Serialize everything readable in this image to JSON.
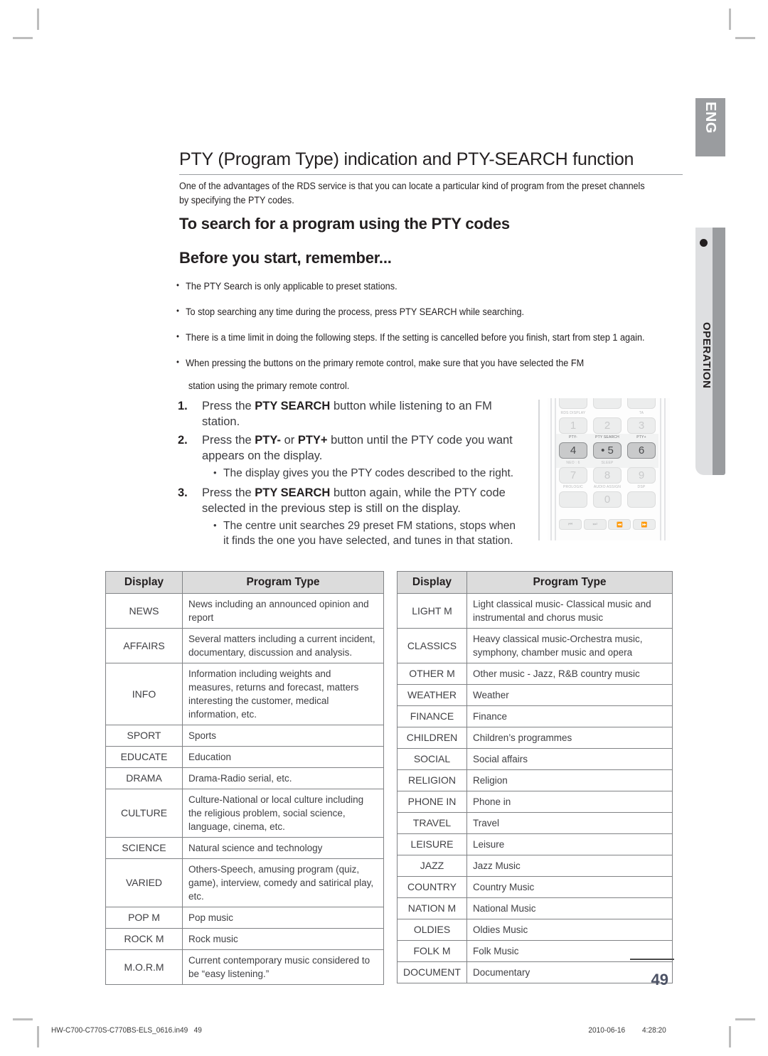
{
  "sidebar": {
    "lang_tab": "ENG",
    "section_tab": "OPERATION"
  },
  "section": {
    "title": "PTY (Program Type) indication and PTY-SEARCH function",
    "intro": "One  of the advantages of the RDS service is that you can locate a particular kind of program from the preset channels by specifying the PTY codes.",
    "heading_1": "To search for a program using the PTY codes",
    "heading_2": "Before you start, remember..."
  },
  "notes": [
    "The PTY Search is only applicable to preset stations.",
    "To stop searching any time during the process, press PTY SEARCH while searching.",
    "There is a time limit in doing the following steps. If the setting is cancelled before you finish,  start from step 1 again.",
    "When pressing the buttons on the primary remote control, make sure that you have selected the FM",
    "station using the primary remote control."
  ],
  "steps": [
    {
      "number": "1.",
      "text_before": "Press the ",
      "bold": "PTY SEARCH",
      "text_after": " button while listening to an FM station.",
      "sub": []
    },
    {
      "number": "2.",
      "text_before": "Press the ",
      "bold": "PTY-",
      "mid": " or ",
      "bold2": "PTY+",
      "text_after": " button until the PTY code you want appears on the display.",
      "sub": [
        "The display gives you the PTY codes described to the right."
      ]
    },
    {
      "number": "3.",
      "text_before": "Press the ",
      "bold": "PTY SEARCH",
      "text_after": " button again, while the PTY code selected in the previous step is still on the display.",
      "sub": [
        "The centre unit searches 29 preset FM stations, stops when it finds the one you have selected, and tunes in that station."
      ]
    }
  ],
  "remote": {
    "labels_row1": [
      "RDS DISPLAY",
      "",
      "TA"
    ],
    "keys_row1": [
      "1",
      "2",
      "3"
    ],
    "labels_row2": [
      "PTY-",
      "PTY SEARCH",
      "PTY+"
    ],
    "keys_row2": [
      "4",
      "• 5",
      "6"
    ],
    "labels_row3": [
      "NEO : 6",
      "SLEEP",
      ""
    ],
    "keys_row3": [
      "7",
      "8",
      "9"
    ],
    "labels_row4": [
      "PROLOGIC",
      "AUDIO ASSIGN",
      "DSP"
    ],
    "keys_row4": [
      "",
      "0",
      ""
    ],
    "transport": [
      "⏮",
      "⏭",
      "⏪",
      "⏩"
    ]
  },
  "table_left": {
    "headers": [
      "Display",
      "Program Type"
    ],
    "rows": [
      [
        "NEWS",
        "News including an announced opinion and report"
      ],
      [
        "AFFAIRS",
        "Several matters including a current incident, documentary, discussion and analysis."
      ],
      [
        "INFO",
        "Information including weights and measures, returns and forecast, matters interesting the customer, medical information, etc."
      ],
      [
        "SPORT",
        "Sports"
      ],
      [
        "EDUCATE",
        "Education"
      ],
      [
        "DRAMA",
        "Drama-Radio serial, etc."
      ],
      [
        "CULTURE",
        "Culture-National or local culture including the religious problem, social science, language, cinema, etc."
      ],
      [
        "SCIENCE",
        "Natural science and technology"
      ],
      [
        "VARIED",
        "Others-Speech, amusing program (quiz, game), interview, comedy and satirical play, etc."
      ],
      [
        "POP M",
        "Pop music"
      ],
      [
        "ROCK M",
        "Rock music"
      ],
      [
        "M.O.R.M",
        "Current contemporary music considered to be “easy listening.”"
      ]
    ]
  },
  "table_right": {
    "headers": [
      "Display",
      "Program Type"
    ],
    "rows": [
      [
        "LIGHT M",
        "Light classical music- Classical music and instrumental and chorus music"
      ],
      [
        "CLASSICS",
        "Heavy classical  music-Orchestra music, symphony, chamber music and opera"
      ],
      [
        "OTHER M",
        "Other music - Jazz, R&B country music"
      ],
      [
        "WEATHER",
        "Weather"
      ],
      [
        "FINANCE",
        "Finance"
      ],
      [
        "CHILDREN",
        "Children’s programmes"
      ],
      [
        "SOCIAL",
        "Social affairs"
      ],
      [
        "RELIGION",
        "Religion"
      ],
      [
        "PHONE IN",
        "Phone in"
      ],
      [
        "TRAVEL",
        "Travel"
      ],
      [
        "LEISURE",
        "Leisure"
      ],
      [
        "JAZZ",
        "Jazz Music"
      ],
      [
        "COUNTRY",
        "Country Music"
      ],
      [
        "NATION M",
        "National Music"
      ],
      [
        "OLDIES",
        "Oldies Music"
      ],
      [
        "FOLK M",
        "Folk Music"
      ],
      [
        "DOCUMENT",
        "Documentary"
      ]
    ]
  },
  "page_number": "49",
  "footer": {
    "file": "HW-C700-C770S-C770BS-ELS_0616.in49",
    "page": "49",
    "date": "2010-06-16",
    "time": "4:28:20"
  }
}
